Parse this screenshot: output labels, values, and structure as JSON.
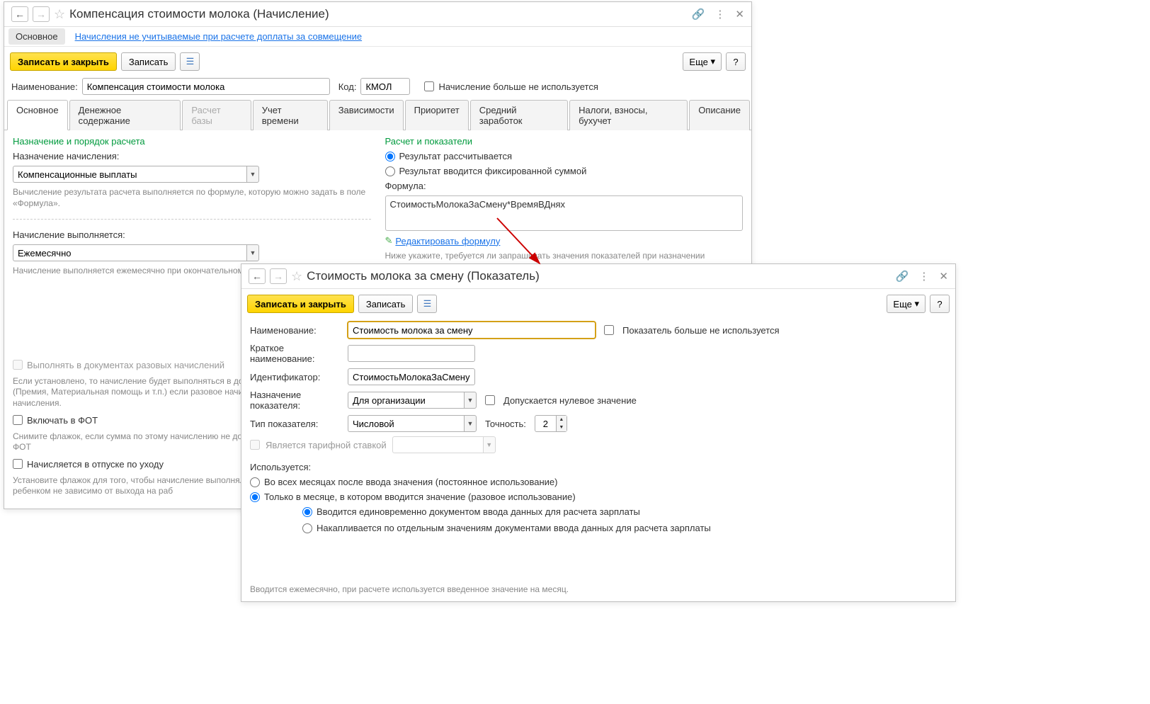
{
  "win1": {
    "title": "Компенсация стоимости молока (Начисление)",
    "subnav": {
      "main": "Основное",
      "link": "Начисления не учитываемые при расчете доплаты за совмещение"
    },
    "toolbar": {
      "save_close": "Записать и закрыть",
      "save": "Записать",
      "more": "Еще",
      "help": "?"
    },
    "name_label": "Наименование:",
    "name_value": "Компенсация стоимости молока",
    "code_label": "Код:",
    "code_value": "КМОЛ",
    "not_used_cb": "Начисление больше не используется",
    "tabs": [
      "Основное",
      "Денежное содержание",
      "Расчет базы",
      "Учет времени",
      "Зависимости",
      "Приоритет",
      "Средний заработок",
      "Налоги, взносы, бухучет",
      "Описание"
    ],
    "left": {
      "group": "Назначение и порядок расчета",
      "assign_label": "Назначение начисления:",
      "assign_value": "Компенсационные выплаты",
      "assign_hint": "Вычисление результата расчета выполняется по формуле, которую можно задать в поле «Формула».",
      "exec_label": "Начисление выполняется:",
      "exec_value": "Ежемесячно",
      "exec_hint": "Начисление выполняется ежемесячно при окончательном расчете",
      "single_cb": "Выполнять в документах разовых начислений",
      "single_hint": "Если установлено, то начисление будет выполняться в документах разовых начислений (Премия, Материальная помощь и т.п.) если разовое начисление входит в базу текущего начисления.",
      "fot_cb": "Включать в ФОТ",
      "fot_hint": "Снимите флажок, если сумма по этому начислению не должна быть включена в состав ФОТ",
      "leave_cb": "Начисляется в отпуске по уходу",
      "leave_hint": "Установите флажок для того, чтобы начисление выполнялось в отпуске по уходу за ребенком не зависимо от выхода на раб"
    },
    "right": {
      "group": "Расчет и показатели",
      "r1": "Результат рассчитывается",
      "r2": "Результат вводится фиксированной суммой",
      "formula_label": "Формула:",
      "formula_value": "СтоимостьМолокаЗаСмену*ВремяВДнях",
      "edit_link": "Редактировать формулу",
      "formula_hint": "Ниже укажите, требуется ли запрашивать значения показателей при назначении начисления в кадровых приказах и очищать значения при отмене начисления"
    }
  },
  "win2": {
    "title": "Стоимость молока за смену (Показатель)",
    "toolbar": {
      "save_close": "Записать и закрыть",
      "save": "Записать",
      "more": "Еще",
      "help": "?"
    },
    "name_label": "Наименование:",
    "name_value": "Стоимость молока за смену",
    "not_used_cb": "Показатель больше не используется",
    "short_label": "Краткое наименование:",
    "short_value": "",
    "id_label": "Идентификатор:",
    "id_value": "СтоимостьМолокаЗаСмену",
    "purpose_label": "Назначение показателя:",
    "purpose_value": "Для организации",
    "zero_cb": "Допускается нулевое значение",
    "type_label": "Тип показателя:",
    "type_value": "Числовой",
    "precision_label": "Точность:",
    "precision_value": "2",
    "tariff_cb": "Является тарифной ставкой",
    "usage_label": "Используется:",
    "u1": "Во всех месяцах после ввода значения (постоянное использование)",
    "u2": "Только в месяце, в котором вводится значение (разовое использование)",
    "u2a": "Вводится единовременно документом ввода данных для расчета зарплаты",
    "u2b": "Накапливается по отдельным значениям документами ввода данных для расчета зарплаты",
    "footnote": "Вводится ежемесячно, при расчете используется введенное значение на месяц."
  }
}
